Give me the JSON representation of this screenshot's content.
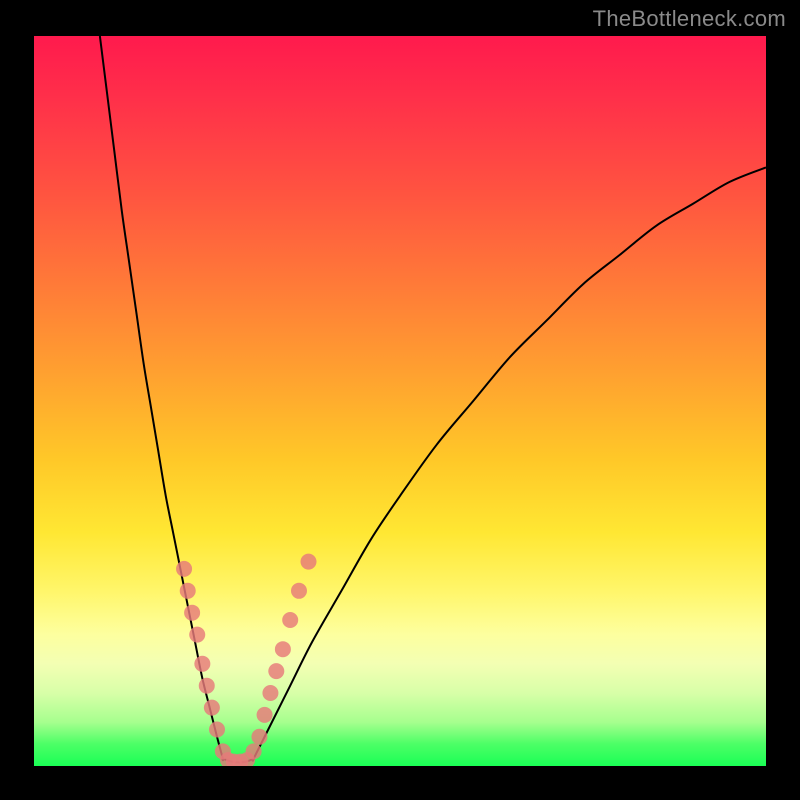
{
  "watermark": "TheBottleneck.com",
  "chart_data": {
    "type": "line",
    "title": "",
    "xlabel": "",
    "ylabel": "",
    "xlim": [
      0,
      100
    ],
    "ylim": [
      0,
      100
    ],
    "grid": false,
    "background": "rainbow-vertical-gradient",
    "series": [
      {
        "name": "bottleneck-curve-left",
        "stroke": "#000000",
        "x": [
          9,
          10,
          11,
          12,
          13,
          14,
          15,
          16,
          17,
          18,
          19,
          20,
          21,
          22,
          23,
          24,
          25,
          25.8
        ],
        "values": [
          100,
          92,
          84,
          76,
          69,
          62,
          55,
          49,
          43,
          37,
          32,
          27,
          22,
          17,
          12,
          8,
          4,
          1
        ]
      },
      {
        "name": "bottleneck-curve-flat",
        "stroke": "#000000",
        "x": [
          25.8,
          27,
          28,
          29,
          30
        ],
        "values": [
          1,
          0.6,
          0.5,
          0.6,
          1
        ]
      },
      {
        "name": "bottleneck-curve-right",
        "stroke": "#000000",
        "x": [
          30,
          32,
          35,
          38,
          42,
          46,
          50,
          55,
          60,
          65,
          70,
          75,
          80,
          85,
          90,
          95,
          100
        ],
        "values": [
          1,
          5,
          11,
          17,
          24,
          31,
          37,
          44,
          50,
          56,
          61,
          66,
          70,
          74,
          77,
          80,
          82
        ]
      }
    ],
    "markers": [
      {
        "name": "left-branch-dots",
        "color": "#e77a7a",
        "radius": 8,
        "points": [
          {
            "x": 20.5,
            "y": 27
          },
          {
            "x": 21.0,
            "y": 24
          },
          {
            "x": 21.6,
            "y": 21
          },
          {
            "x": 22.3,
            "y": 18
          },
          {
            "x": 23.0,
            "y": 14
          },
          {
            "x": 23.6,
            "y": 11
          },
          {
            "x": 24.3,
            "y": 8
          },
          {
            "x": 25.0,
            "y": 5
          },
          {
            "x": 25.8,
            "y": 2
          }
        ]
      },
      {
        "name": "valley-floor-dots",
        "color": "#e77a7a",
        "radius": 8,
        "points": [
          {
            "x": 26.5,
            "y": 0.8
          },
          {
            "x": 27.3,
            "y": 0.6
          },
          {
            "x": 28.2,
            "y": 0.6
          },
          {
            "x": 29.1,
            "y": 0.8
          }
        ]
      },
      {
        "name": "right-branch-dots",
        "color": "#e77a7a",
        "radius": 8,
        "points": [
          {
            "x": 30.0,
            "y": 2
          },
          {
            "x": 30.8,
            "y": 4
          },
          {
            "x": 31.5,
            "y": 7
          },
          {
            "x": 32.3,
            "y": 10
          },
          {
            "x": 33.1,
            "y": 13
          },
          {
            "x": 34.0,
            "y": 16
          },
          {
            "x": 35.0,
            "y": 20
          },
          {
            "x": 36.2,
            "y": 24
          },
          {
            "x": 37.5,
            "y": 28
          }
        ]
      }
    ]
  }
}
